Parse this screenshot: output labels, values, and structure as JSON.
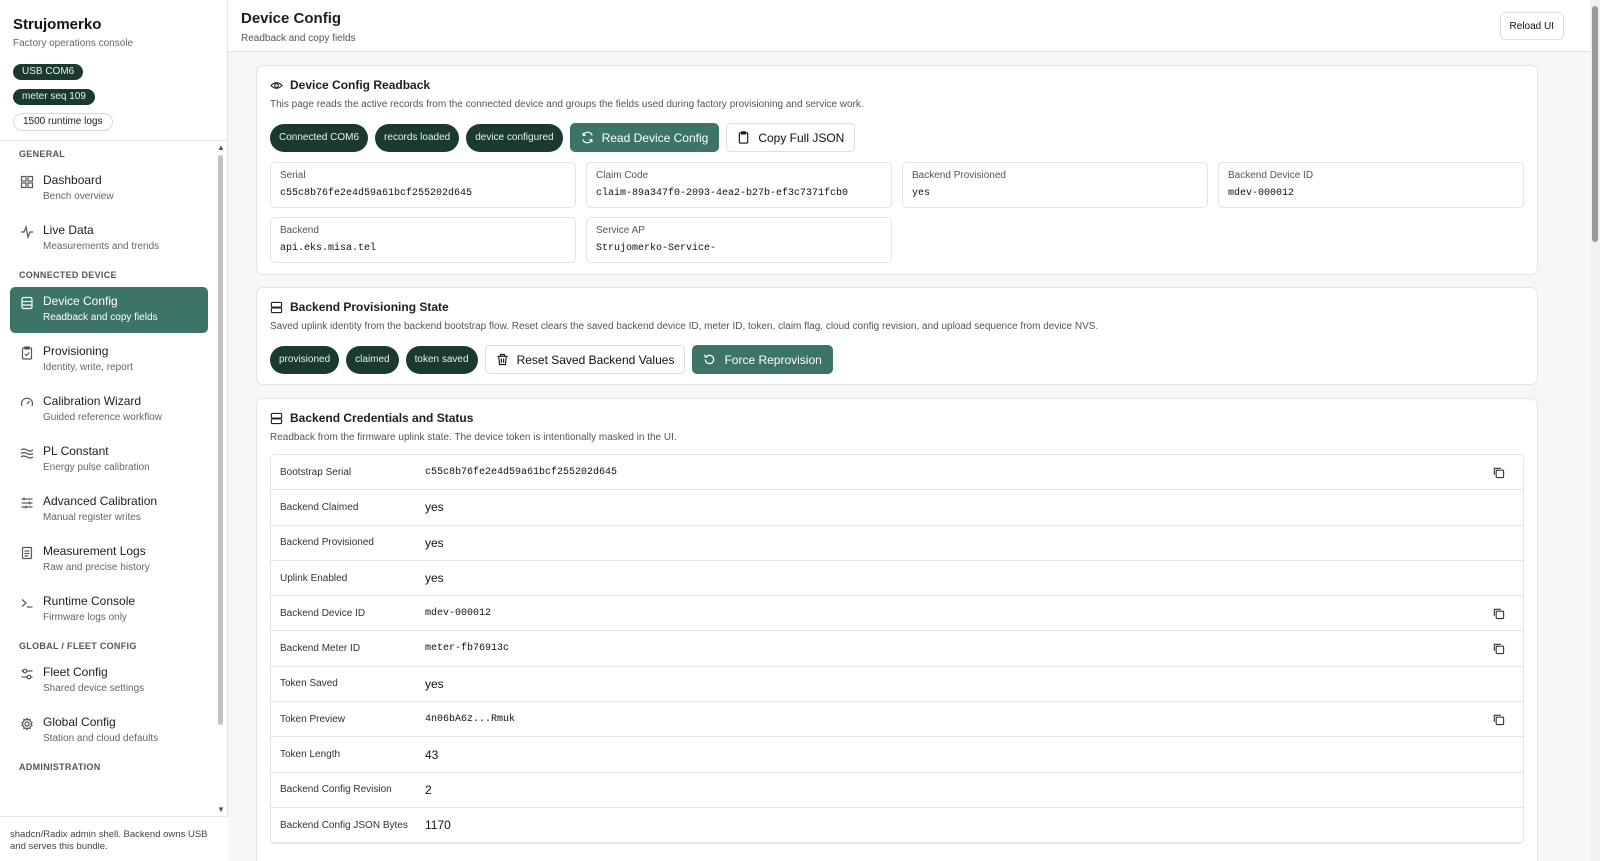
{
  "brand": {
    "title": "Strujomerko",
    "subtitle": "Factory operations console"
  },
  "status_pills": [
    {
      "label": "USB COM6",
      "style": "dark"
    },
    {
      "label": "meter seq 109",
      "style": "dark"
    },
    {
      "label": "1500 runtime logs",
      "style": "light"
    }
  ],
  "nav": {
    "section_general": "GENERAL",
    "section_connected": "CONNECTED DEVICE",
    "section_fleet": "GLOBAL / FLEET CONFIG",
    "section_admin": "ADMINISTRATION",
    "items": [
      {
        "label": "Dashboard",
        "desc": "Bench overview",
        "icon": "grid-icon"
      },
      {
        "label": "Live Data",
        "desc": "Measurements and trends",
        "icon": "activity-icon"
      },
      {
        "label": "Device Config",
        "desc": "Readback and copy fields",
        "icon": "database-icon",
        "active": true
      },
      {
        "label": "Provisioning",
        "desc": "Identity, write, report",
        "icon": "clipboard-check-icon"
      },
      {
        "label": "Calibration Wizard",
        "desc": "Guided reference workflow",
        "icon": "gauge-icon"
      },
      {
        "label": "PL Constant",
        "desc": "Energy pulse calibration",
        "icon": "waves-icon"
      },
      {
        "label": "Advanced Calibration",
        "desc": "Manual register writes",
        "icon": "sliders-icon"
      },
      {
        "label": "Measurement Logs",
        "desc": "Raw and precise history",
        "icon": "log-icon"
      },
      {
        "label": "Runtime Console",
        "desc": "Firmware logs only",
        "icon": "terminal-icon"
      },
      {
        "label": "Fleet Config",
        "desc": "Shared device settings",
        "icon": "settings-sliders-icon"
      },
      {
        "label": "Global Config",
        "desc": "Station and cloud defaults",
        "icon": "gear-icon"
      }
    ]
  },
  "footer_text": "shadcn/Radix admin shell. Backend owns USB and serves this bundle.",
  "header": {
    "title": "Device Config",
    "subtitle": "Readback and copy fields",
    "reload_label": "Reload UI"
  },
  "readback": {
    "title": "Device Config Readback",
    "desc": "This page reads the active records from the connected device and groups the fields used during factory provisioning and service work.",
    "chips": [
      "Connected COM6",
      "records loaded",
      "device configured"
    ],
    "read_button": "Read Device Config",
    "copy_button": "Copy Full JSON",
    "fields": [
      {
        "label": "Serial",
        "value": "c55c8b76fe2e4d59a61bcf255202d645"
      },
      {
        "label": "Claim Code",
        "value": "claim-89a347f0-2093-4ea2-b27b-ef3c7371fcb0"
      },
      {
        "label": "Backend Provisioned",
        "value": "yes"
      },
      {
        "label": "Backend Device ID",
        "value": "mdev-000012"
      },
      {
        "label": "Backend",
        "value": "api.eks.misa.tel"
      },
      {
        "label": "Service AP",
        "value": "Strujomerko-Service-"
      }
    ]
  },
  "provisioning": {
    "title": "Backend Provisioning State",
    "desc": "Saved uplink identity from the backend bootstrap flow. Reset clears the saved backend device ID, meter ID, token, claim flag, cloud config revision, and upload sequence from device NVS.",
    "chips": [
      "provisioned",
      "claimed",
      "token saved"
    ],
    "reset_button": "Reset Saved Backend Values",
    "force_button": "Force Reprovision"
  },
  "credentials": {
    "title": "Backend Credentials and Status",
    "desc": "Readback from the firmware uplink state. The device token is intentionally masked in the UI.",
    "rows": [
      {
        "key": "Bootstrap Serial",
        "value": "c55c8b76fe2e4d59a61bcf255202d645",
        "mono": true,
        "copy": true
      },
      {
        "key": "Backend Claimed",
        "value": "yes"
      },
      {
        "key": "Backend Provisioned",
        "value": "yes"
      },
      {
        "key": "Uplink Enabled",
        "value": "yes"
      },
      {
        "key": "Backend Device ID",
        "value": "mdev-000012",
        "mono": true,
        "copy": true
      },
      {
        "key": "Backend Meter ID",
        "value": "meter-fb76913c",
        "mono": true,
        "copy": true
      },
      {
        "key": "Token Saved",
        "value": "yes"
      },
      {
        "key": "Token Preview",
        "value": "4n06bA6z...Rmuk",
        "mono": true,
        "copy": true
      },
      {
        "key": "Token Length",
        "value": "43"
      },
      {
        "key": "Backend Config Revision",
        "value": "2"
      },
      {
        "key": "Backend Config JSON Bytes",
        "value": "1170"
      }
    ]
  },
  "colors": {
    "accent": "#3d7468",
    "chip_dark": "#1a3a2d"
  }
}
